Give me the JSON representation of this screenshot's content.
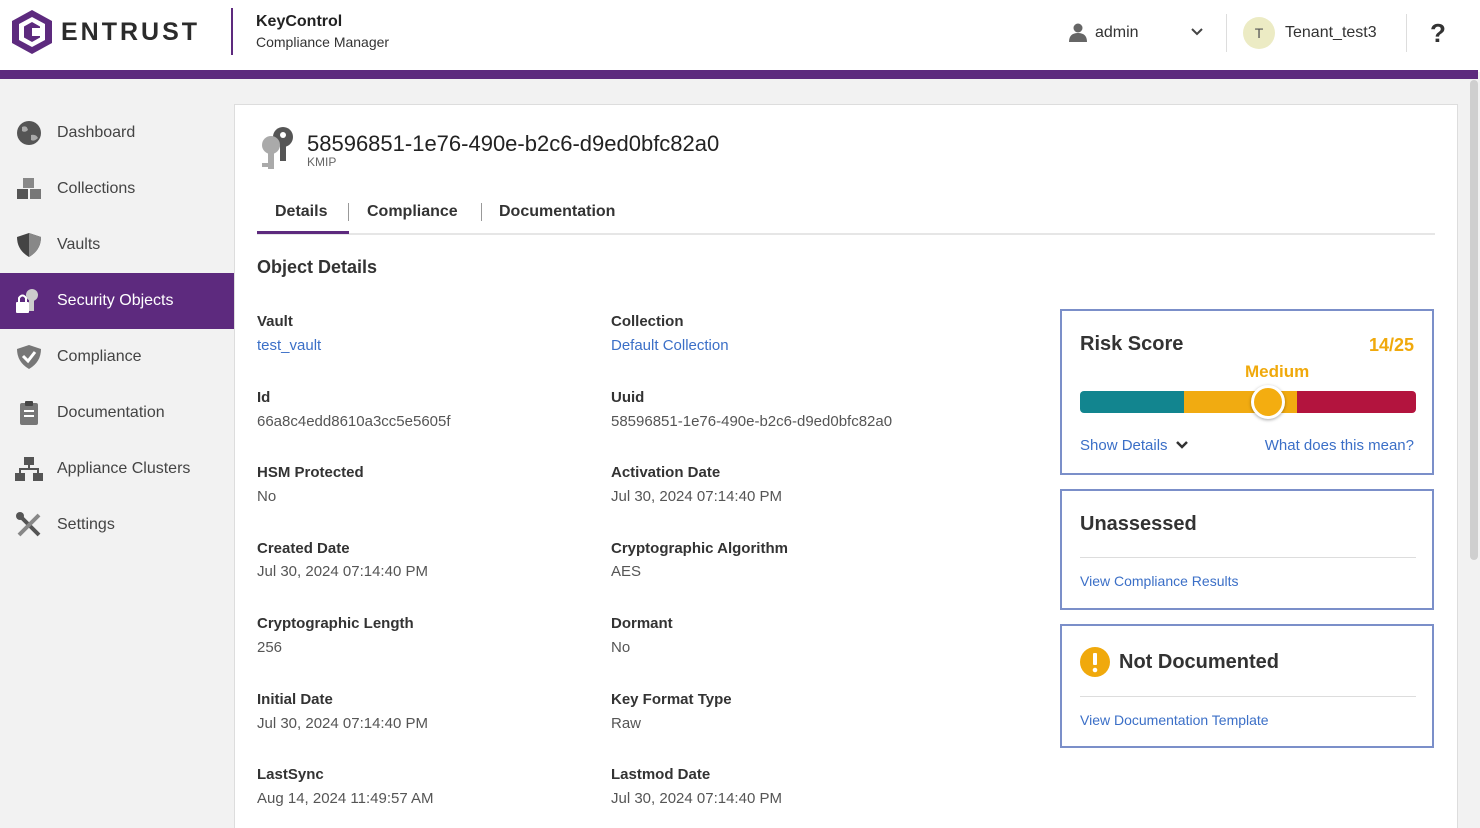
{
  "header": {
    "brand": "ENTRUST",
    "product_name": "KeyControl",
    "product_sub": "Compliance Manager",
    "user": "admin",
    "tenant_initial": "T",
    "tenant_name": "Tenant_test3",
    "help": "?"
  },
  "colors": {
    "brand_purple": "#5d2a7e",
    "link_blue": "#3b6fc7",
    "warning_orange": "#f0a90c",
    "risk_low": "#12858f",
    "risk_medium": "#f1ab11",
    "risk_high": "#b3143e"
  },
  "sidebar": {
    "items": [
      {
        "label": "Dashboard",
        "icon": "globe-icon"
      },
      {
        "label": "Collections",
        "icon": "cubes-icon"
      },
      {
        "label": "Vaults",
        "icon": "shield-icon"
      },
      {
        "label": "Security Objects",
        "icon": "keys-lock-icon",
        "active": true
      },
      {
        "label": "Compliance",
        "icon": "check-shield-icon"
      },
      {
        "label": "Documentation",
        "icon": "clipboard-icon"
      },
      {
        "label": "Appliance Clusters",
        "icon": "network-icon"
      },
      {
        "label": "Settings",
        "icon": "tools-icon"
      }
    ]
  },
  "object": {
    "title": "58596851-1e76-490e-b2c6-d9ed0bfc82a0",
    "type": "KMIP"
  },
  "tabs": [
    {
      "label": "Details",
      "active": true
    },
    {
      "label": "Compliance"
    },
    {
      "label": "Documentation"
    }
  ],
  "details": {
    "section_title": "Object Details",
    "left": [
      {
        "label": "Vault",
        "value": "test_vault",
        "link": true
      },
      {
        "label": "Id",
        "value": "66a8c4edd8610a3cc5e5605f"
      },
      {
        "label": "HSM Protected",
        "value": "No"
      },
      {
        "label": "Created Date",
        "value": "Jul 30, 2024 07:14:40 PM"
      },
      {
        "label": "Cryptographic Length",
        "value": "256"
      },
      {
        "label": "Initial Date",
        "value": "Jul 30, 2024 07:14:40 PM"
      },
      {
        "label": "LastSync",
        "value": "Aug 14, 2024 11:49:57 AM"
      }
    ],
    "right": [
      {
        "label": "Collection",
        "value": "Default Collection",
        "link": true
      },
      {
        "label": "Uuid",
        "value": "58596851-1e76-490e-b2c6-d9ed0bfc82a0"
      },
      {
        "label": "Activation Date",
        "value": "Jul 30, 2024 07:14:40 PM"
      },
      {
        "label": "Cryptographic Algorithm",
        "value": "AES"
      },
      {
        "label": "Dormant",
        "value": "No"
      },
      {
        "label": "Key Format Type",
        "value": "Raw"
      },
      {
        "label": "Lastmod Date",
        "value": "Jul 30, 2024 07:14:40 PM"
      }
    ]
  },
  "risk": {
    "title": "Risk Score",
    "score": "14/25",
    "score_value": 14,
    "score_max": 25,
    "level": "Medium",
    "show_details": "Show Details",
    "what_means": "What does this mean?"
  },
  "compliance_card": {
    "status": "Unassessed",
    "link": "View Compliance Results"
  },
  "documentation_card": {
    "status": "Not Documented",
    "link": "View Documentation Template",
    "icon": "warning-icon"
  }
}
